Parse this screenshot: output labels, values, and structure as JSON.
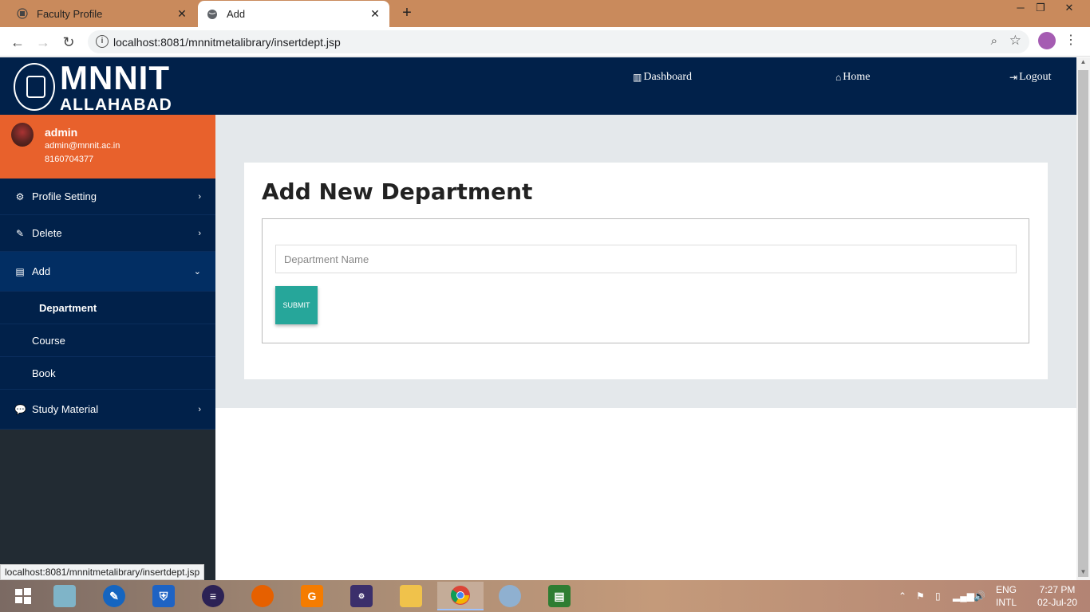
{
  "browser": {
    "tabs": [
      {
        "title": "Faculty Profile",
        "active": false
      },
      {
        "title": "Add",
        "active": true
      }
    ],
    "url": "localhost:8081/mnnitmetalibrary/insertdept.jsp",
    "status_url": "localhost:8081/mnnitmetalibrary/insertdept.jsp"
  },
  "header": {
    "logo_line1": "MNNIT",
    "logo_line2": "ALLAHABAD",
    "nav": {
      "dashboard": "Dashboard",
      "home": "Home",
      "logout": "Logout"
    }
  },
  "profile": {
    "name": "admin",
    "email": "admin@mnnit.ac.in",
    "phone": "8160704377"
  },
  "sidebar": {
    "items": [
      {
        "label": "Profile Setting",
        "icon": "gears-icon"
      },
      {
        "label": "Delete",
        "icon": "pencil-icon"
      },
      {
        "label": "Add",
        "icon": "book-icon",
        "expanded": true
      },
      {
        "label": "Study Material",
        "icon": "comments-icon"
      }
    ],
    "add_subitems": [
      "Department",
      "Course",
      "Book"
    ]
  },
  "main": {
    "title": "Add New Department",
    "dept_placeholder": "Department Name",
    "submit_label": "SUBMIT"
  },
  "taskbar": {
    "lang_line1": "ENG",
    "lang_line2": "INTL",
    "time": "7:27 PM",
    "date": "02-Jul-20",
    "apps": [
      "start-icon",
      "notepad-icon",
      "network-tool-icon",
      "security-shield-icon",
      "eclipse-icon",
      "firefox-icon",
      "pdf-editor-icon",
      "java-ee-ide-icon",
      "file-explorer-icon",
      "chrome-icon",
      "paint-icon",
      "reader-icon"
    ]
  },
  "colors": {
    "header_bg": "#01214a",
    "profile_bg": "#e8612c",
    "submit_bg": "#26a69a"
  }
}
